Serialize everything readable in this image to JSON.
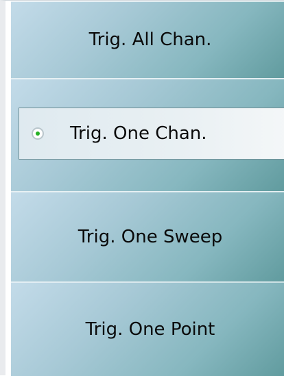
{
  "menu": {
    "items": [
      {
        "label": "Trig. All Chan.",
        "selected": false
      },
      {
        "label": "Trig. One Chan.",
        "selected": true
      },
      {
        "label": "Trig. One Sweep",
        "selected": false
      },
      {
        "label": "Trig. One Point",
        "selected": false
      }
    ],
    "colors": {
      "gradient_start": "#c3dbe9",
      "gradient_end": "#5f9a9d",
      "selected_bg": "#e9f0f3",
      "radio_dot": "#25b025"
    },
    "icons": {
      "selected_indicator": "radio-selected-icon"
    }
  }
}
